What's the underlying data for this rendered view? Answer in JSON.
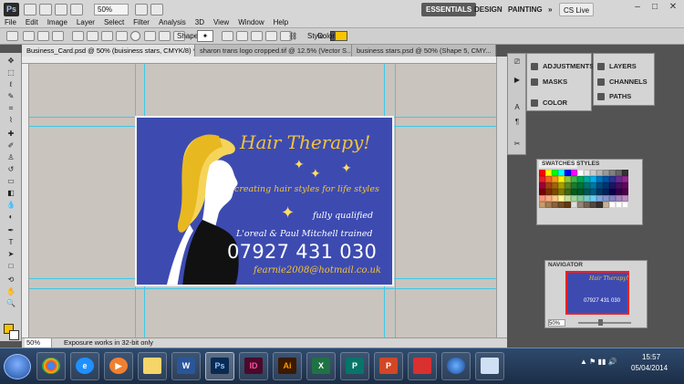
{
  "app": {
    "logo": "Ps",
    "zoom": "50%",
    "workspaces": [
      "ESSENTIALS",
      "DESIGN",
      "PAINTING",
      "»"
    ],
    "cs_live": "CS Live",
    "window_controls": [
      "–",
      "□",
      "✕"
    ]
  },
  "menu": [
    "File",
    "Edit",
    "Image",
    "Layer",
    "Select",
    "Filter",
    "Analysis",
    "3D",
    "View",
    "Window",
    "Help"
  ],
  "options_bar": {
    "shape_label": "Shape:",
    "style_label": "Style:",
    "color_label": "Color:",
    "color_value": "#f7c500"
  },
  "tabs": [
    {
      "label": "Business_Card.psd @ 50% (buisiness stars, CMYK/8) *",
      "active": true
    },
    {
      "label": "sharon trans logo cropped.tif @ 12.5% (Vector S...",
      "active": false
    },
    {
      "label": "business stars.psd @ 50% (Shape 5, CMY...",
      "active": false
    }
  ],
  "card": {
    "title": "Hair Therapy!",
    "tagline": "creating hair styles for life styles",
    "qualified": "fully qualified",
    "trained": "L'oreal & Paul Mitchell trained",
    "phone": "07927 431 030",
    "email": "fearnie2008@hotmail.co.uk",
    "background": "#3d4bb0",
    "accent": "#f3c33b"
  },
  "status": {
    "zoom": "50%",
    "message": "Exposure works in 32-bit only"
  },
  "panels": {
    "adjustments": "ADJUSTMENTS",
    "masks": "MASKS",
    "color": "COLOR",
    "layers": "LAYERS",
    "channels": "CHANNELS",
    "paths": "PATHS",
    "swatches_tab": "SWATCHES",
    "styles_tab": "STYLES",
    "navigator": "NAVIGATOR",
    "navigator_zoom": "50%"
  },
  "taskbar": {
    "apps": [
      {
        "icon": "chrome-icon",
        "label": ""
      },
      {
        "icon": "ie-icon",
        "label": "e"
      },
      {
        "icon": "media-icon",
        "label": "▶"
      },
      {
        "icon": "explorer-icon",
        "label": ""
      },
      {
        "icon": "word-icon",
        "label": "W"
      },
      {
        "icon": "photoshop-icon",
        "label": "Ps"
      },
      {
        "icon": "indesign-icon",
        "label": "ID"
      },
      {
        "icon": "illustrator-icon",
        "label": "Ai"
      },
      {
        "icon": "excel-icon",
        "label": "X"
      },
      {
        "icon": "publisher-icon",
        "label": "P"
      },
      {
        "icon": "powerpoint-icon",
        "label": "P"
      },
      {
        "icon": "snagit-icon",
        "label": ""
      },
      {
        "icon": "earth-icon",
        "label": ""
      },
      {
        "icon": "window-icon",
        "label": ""
      }
    ],
    "time": "15:57",
    "date": "05/04/2014"
  }
}
